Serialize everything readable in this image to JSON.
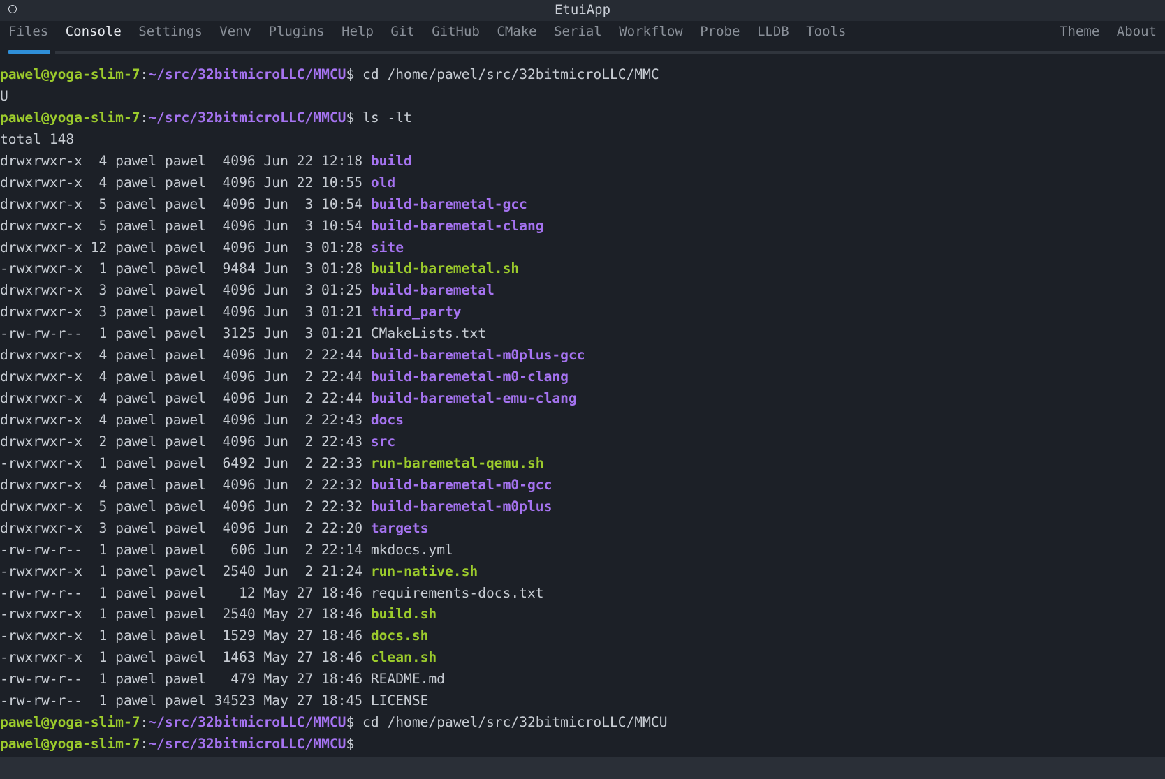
{
  "window": {
    "title": "EtuiApp"
  },
  "tabs_left": [
    {
      "label": "Files",
      "active": false
    },
    {
      "label": "Console",
      "active": true
    },
    {
      "label": "Settings",
      "active": false
    },
    {
      "label": "Venv",
      "active": false
    },
    {
      "label": "Plugins",
      "active": false
    },
    {
      "label": "Help",
      "active": false
    },
    {
      "label": "Git",
      "active": false
    },
    {
      "label": "GitHub",
      "active": false
    },
    {
      "label": "CMake",
      "active": false
    },
    {
      "label": "Serial",
      "active": false
    },
    {
      "label": "Workflow",
      "active": false
    },
    {
      "label": "Probe",
      "active": false
    },
    {
      "label": "LLDB",
      "active": false
    },
    {
      "label": "Tools",
      "active": false
    }
  ],
  "tabs_right": [
    {
      "label": "Theme"
    },
    {
      "label": "About"
    }
  ],
  "prompt": {
    "user_host": "pawel@yoga-slim-7",
    "separator": ":",
    "path": "~/src/32bitmicroLLC/MMCU",
    "symbol": "$"
  },
  "colors": {
    "background": "#1c2027",
    "prompt_user": "#9ccb2c",
    "directory": "#a573f0",
    "executable": "#9ccb2c",
    "active_tab_underline": "#2f8fd8"
  },
  "console_lines": [
    {
      "type": "prompt",
      "command": " cd /home/pawel/src/32bitmicroLLC/MMC"
    },
    {
      "type": "text",
      "text": "U"
    },
    {
      "type": "prompt",
      "command": " ls -lt"
    },
    {
      "type": "text",
      "text": "total 148"
    },
    {
      "type": "entry",
      "info": "drwxrwxr-x  4 pawel pawel  4096 Jun 22 12:18 ",
      "name": "build",
      "kind": "dir"
    },
    {
      "type": "entry",
      "info": "drwxrwxr-x  4 pawel pawel  4096 Jun 22 10:55 ",
      "name": "old",
      "kind": "dir"
    },
    {
      "type": "entry",
      "info": "drwxrwxr-x  5 pawel pawel  4096 Jun  3 10:54 ",
      "name": "build-baremetal-gcc",
      "kind": "dir"
    },
    {
      "type": "entry",
      "info": "drwxrwxr-x  5 pawel pawel  4096 Jun  3 10:54 ",
      "name": "build-baremetal-clang",
      "kind": "dir"
    },
    {
      "type": "entry",
      "info": "drwxrwxr-x 12 pawel pawel  4096 Jun  3 01:28 ",
      "name": "site",
      "kind": "dir"
    },
    {
      "type": "entry",
      "info": "-rwxrwxr-x  1 pawel pawel  9484 Jun  3 01:28 ",
      "name": "build-baremetal.sh",
      "kind": "exe"
    },
    {
      "type": "entry",
      "info": "drwxrwxr-x  3 pawel pawel  4096 Jun  3 01:25 ",
      "name": "build-baremetal",
      "kind": "dir"
    },
    {
      "type": "entry",
      "info": "drwxrwxr-x  3 pawel pawel  4096 Jun  3 01:21 ",
      "name": "third_party",
      "kind": "dir"
    },
    {
      "type": "entry",
      "info": "-rw-rw-r--  1 pawel pawel  3125 Jun  3 01:21 ",
      "name": "CMakeLists.txt",
      "kind": "file"
    },
    {
      "type": "entry",
      "info": "drwxrwxr-x  4 pawel pawel  4096 Jun  2 22:44 ",
      "name": "build-baremetal-m0plus-gcc",
      "kind": "dir"
    },
    {
      "type": "entry",
      "info": "drwxrwxr-x  4 pawel pawel  4096 Jun  2 22:44 ",
      "name": "build-baremetal-m0-clang",
      "kind": "dir"
    },
    {
      "type": "entry",
      "info": "drwxrwxr-x  4 pawel pawel  4096 Jun  2 22:44 ",
      "name": "build-baremetal-emu-clang",
      "kind": "dir"
    },
    {
      "type": "entry",
      "info": "drwxrwxr-x  4 pawel pawel  4096 Jun  2 22:43 ",
      "name": "docs",
      "kind": "dir"
    },
    {
      "type": "entry",
      "info": "drwxrwxr-x  2 pawel pawel  4096 Jun  2 22:43 ",
      "name": "src",
      "kind": "dir"
    },
    {
      "type": "entry",
      "info": "-rwxrwxr-x  1 pawel pawel  6492 Jun  2 22:33 ",
      "name": "run-baremetal-qemu.sh",
      "kind": "exe"
    },
    {
      "type": "entry",
      "info": "drwxrwxr-x  4 pawel pawel  4096 Jun  2 22:32 ",
      "name": "build-baremetal-m0-gcc",
      "kind": "dir"
    },
    {
      "type": "entry",
      "info": "drwxrwxr-x  5 pawel pawel  4096 Jun  2 22:32 ",
      "name": "build-baremetal-m0plus",
      "kind": "dir"
    },
    {
      "type": "entry",
      "info": "drwxrwxr-x  3 pawel pawel  4096 Jun  2 22:20 ",
      "name": "targets",
      "kind": "dir"
    },
    {
      "type": "entry",
      "info": "-rw-rw-r--  1 pawel pawel   606 Jun  2 22:14 ",
      "name": "mkdocs.yml",
      "kind": "file"
    },
    {
      "type": "entry",
      "info": "-rwxrwxr-x  1 pawel pawel  2540 Jun  2 21:24 ",
      "name": "run-native.sh",
      "kind": "exe"
    },
    {
      "type": "entry",
      "info": "-rw-rw-r--  1 pawel pawel    12 May 27 18:46 ",
      "name": "requirements-docs.txt",
      "kind": "file"
    },
    {
      "type": "entry",
      "info": "-rwxrwxr-x  1 pawel pawel  2540 May 27 18:46 ",
      "name": "build.sh",
      "kind": "exe"
    },
    {
      "type": "entry",
      "info": "-rwxrwxr-x  1 pawel pawel  1529 May 27 18:46 ",
      "name": "docs.sh",
      "kind": "exe"
    },
    {
      "type": "entry",
      "info": "-rwxrwxr-x  1 pawel pawel  1463 May 27 18:46 ",
      "name": "clean.sh",
      "kind": "exe"
    },
    {
      "type": "entry",
      "info": "-rw-rw-r--  1 pawel pawel   479 May 27 18:46 ",
      "name": "README.md",
      "kind": "file"
    },
    {
      "type": "entry",
      "info": "-rw-rw-r--  1 pawel pawel 34523 May 27 18:45 ",
      "name": "LICENSE",
      "kind": "file"
    },
    {
      "type": "prompt",
      "command": " cd /home/pawel/src/32bitmicroLLC/MMCU"
    },
    {
      "type": "prompt",
      "command": ""
    }
  ]
}
